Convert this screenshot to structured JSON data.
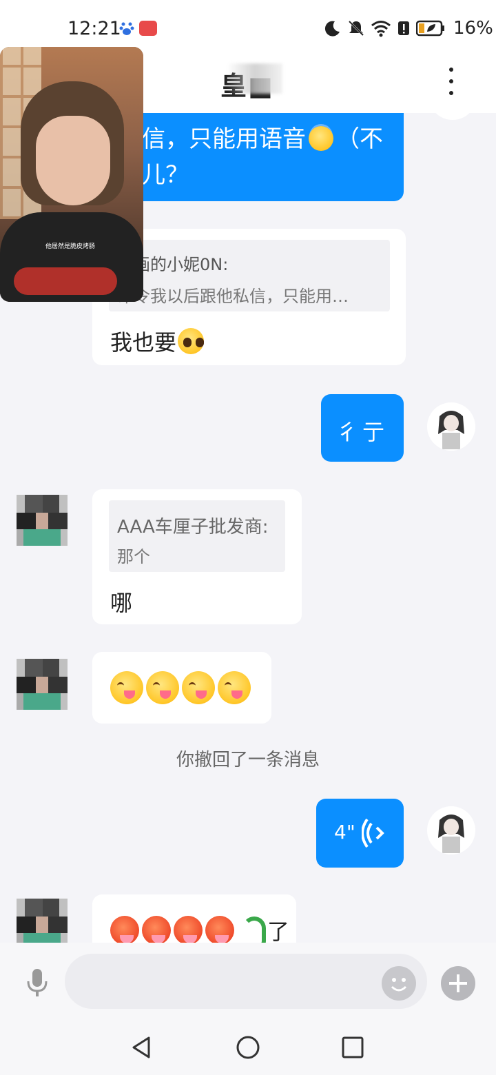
{
  "status_bar": {
    "time": "12:21",
    "battery_percent": "16%",
    "icons": [
      "baidu-paw-icon",
      "red-app-icon",
      "moon-icon",
      "mute-bell-icon",
      "wifi-icon",
      "alert-icon",
      "battery-leaf-icon"
    ]
  },
  "header": {
    "title": "皇■",
    "menu_icon": "more-vertical-icon"
  },
  "pip_video": {
    "caption": "他居然是脆皮烤肠"
  },
  "messages": {
    "m1": {
      "text_line1": "信，只能用语音",
      "emoji": "smiling-face-with-halo",
      "text_line1_suffix": "（不",
      "text_line2": "儿？"
    },
    "m2": {
      "quote_author": "画画的小妮0N:",
      "quote_text": "命令我以后跟他私信，只能用…",
      "text": "我也要",
      "emoji": "pleading-face"
    },
    "m3": {
      "text": "彳亍"
    },
    "m4": {
      "quote_author": "AAA车厘子批发商:",
      "quote_text": "那个",
      "text": "哪"
    },
    "m5": {
      "emojis": [
        "face-savoring-food",
        "face-savoring-food",
        "face-savoring-food",
        "face-savoring-food"
      ]
    },
    "system": {
      "text": "你撤回了一条消息"
    },
    "m6": {
      "duration": "4\"",
      "icon": "voice-wave-icon"
    },
    "m7": {
      "emojis": [
        "hot-face",
        "hot-face",
        "hot-face",
        "hot-face",
        "snake"
      ],
      "text": "了"
    }
  },
  "input_bar": {
    "mic_icon": "microphone-icon",
    "emoji_icon": "smiley-icon",
    "plus_icon": "plus-icon"
  },
  "nav_bar": {
    "back_icon": "triangle-back-icon",
    "home_icon": "circle-home-icon",
    "recents_icon": "square-recents-icon"
  },
  "colors": {
    "outgoing_bubble": "#0b8fff",
    "incoming_bubble": "#ffffff",
    "background": "#f4f4f8"
  }
}
